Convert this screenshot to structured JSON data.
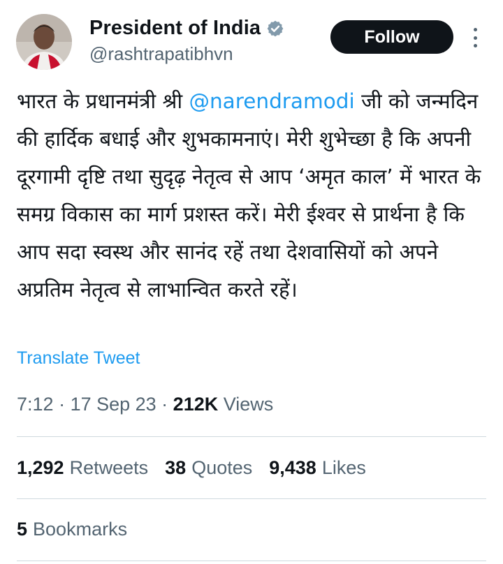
{
  "author": {
    "display_name": "President of India",
    "handle": "@rashtrapatibhvn",
    "verified_icon": "verified-badge-icon",
    "verified_color": "#829aab"
  },
  "actions": {
    "follow_label": "Follow",
    "more_icon": "more-vertical-icon"
  },
  "tweet": {
    "text_before_mention": "भारत के प्रधानमंत्री श्री ",
    "mention": "@narendramodi",
    "text_after_mention": " जी को जन्मदिन की हार्दिक बधाई और शुभकामनाएं। मेरी शुभेच्छा है कि अपनी दूरगामी दृष्टि तथा सुदृढ़ नेतृत्व से आप ‘अमृत काल’ में भारत के समग्र विकास का मार्ग प्रशस्त करें। मेरी ईश्वर से प्रार्थना है कि आप सदा स्वस्थ और सानंद रहें तथा देशवासियों को अपने अप्रतिम नेतृत्व से लाभान्वित करते रहें।",
    "translate_label": "Translate Tweet"
  },
  "meta": {
    "time": "7:12",
    "separator": " · ",
    "date": "17 Sep 23",
    "views_count": "212K",
    "views_label": "Views"
  },
  "stats": [
    {
      "count": "1,292",
      "label": "Retweets"
    },
    {
      "count": "38",
      "label": "Quotes"
    },
    {
      "count": "9,438",
      "label": "Likes"
    }
  ],
  "bookmarks": {
    "count": "5",
    "label": "Bookmarks"
  },
  "colors": {
    "link": "#1d9bf0",
    "text_primary": "#0f1419",
    "text_secondary": "#536471",
    "divider": "#cfd9de",
    "button_bg": "#0f1419"
  }
}
